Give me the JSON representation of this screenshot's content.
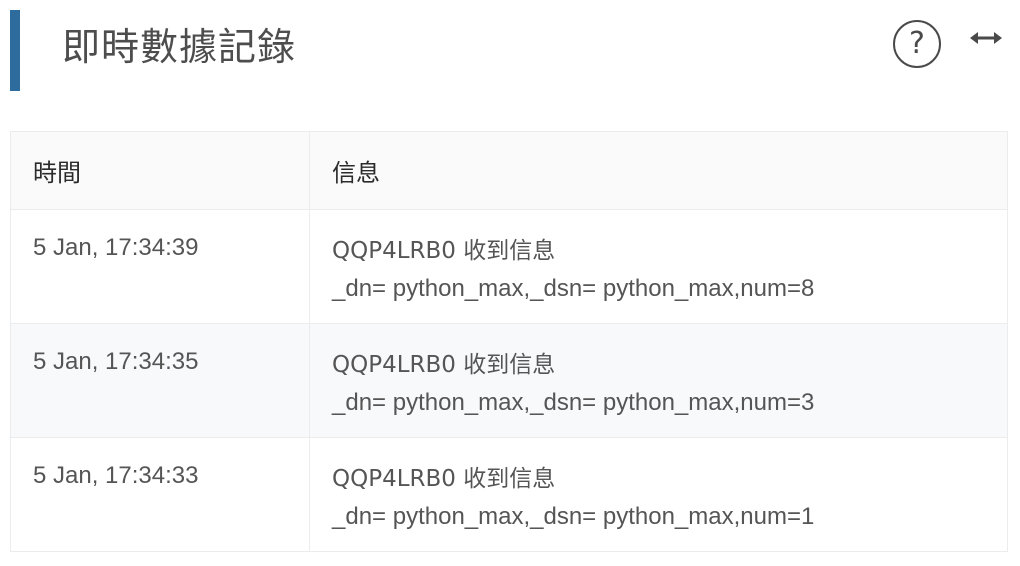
{
  "header": {
    "title": "即時數據記錄",
    "help_icon": "question-circle-icon",
    "help_symbol": "?",
    "expand_icon": "horizontal-arrows-icon",
    "accent_color": "#2f6c9e"
  },
  "table": {
    "columns": [
      "時間",
      "信息"
    ],
    "rows": [
      {
        "time": "5 Jan, 17:34:39",
        "msg_line1": "QQP4LRB0 收到信息",
        "msg_line2": "_dn= python_max,_dsn= python_max,num=8"
      },
      {
        "time": "5 Jan, 17:34:35",
        "msg_line1": "QQP4LRB0 收到信息",
        "msg_line2": "_dn= python_max,_dsn= python_max,num=3"
      },
      {
        "time": "5 Jan, 17:34:33",
        "msg_line1": "QQP4LRB0 收到信息",
        "msg_line2": "_dn= python_max,_dsn= python_max,num=1"
      }
    ]
  }
}
